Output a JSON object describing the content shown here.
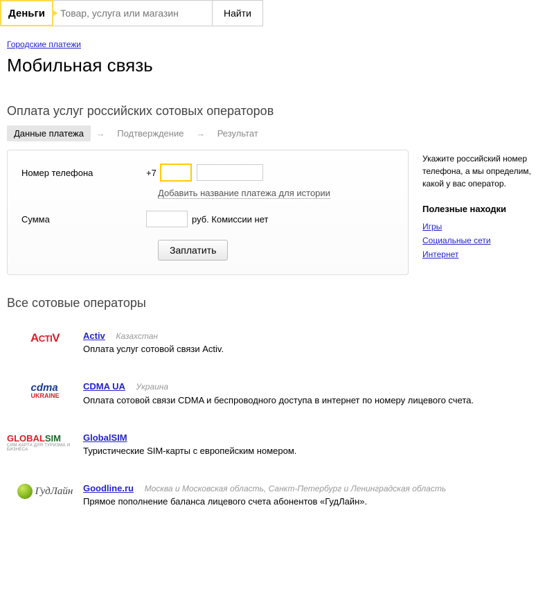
{
  "header": {
    "logo": "Деньги",
    "search_placeholder": "Товар, услуга или магазин",
    "search_button": "Найти"
  },
  "breadcrumb": {
    "parent": "Городские платежи"
  },
  "page_title": "Мобильная связь",
  "form_section_title": "Оплата услуг российских сотовых операторов",
  "steps": {
    "s1": "Данные платежа",
    "s2": "Подтверждение",
    "s3": "Результат"
  },
  "form": {
    "phone_label": "Номер телефона",
    "phone_prefix": "+7",
    "history_link": "Добавить название платежа для истории",
    "amount_label": "Сумма",
    "amount_suffix": "руб. Комиссии нет",
    "pay_button": "Заплатить"
  },
  "sidebar": {
    "hint": "Укажите российский номер телефона, а мы определим, какой у вас оператор.",
    "links_title": "Полезные находки",
    "links": {
      "l1": "Игры",
      "l2": "Социальные сети",
      "l3": "Интернет"
    }
  },
  "operators_title": "Все сотовые операторы",
  "operators": [
    {
      "name": "Activ",
      "region": "Казахстан",
      "desc": "Оплата услуг сотовой связи Activ."
    },
    {
      "name": "CDMA UA",
      "region": "Украина",
      "desc": "Оплата сотовой связи CDMA и беспроводного доступа в интернет по номеру лицевого счета."
    },
    {
      "name": "GlobalSIM",
      "region": "",
      "desc": "Туристические SIM-карты с европейским номером."
    },
    {
      "name": "Goodline.ru",
      "region": "Москва и Московская область, Санкт-Петербург и Ленинградская область",
      "desc": "Прямое пополнение баланса лицевого счета абонентов «ГудЛайн»."
    }
  ]
}
